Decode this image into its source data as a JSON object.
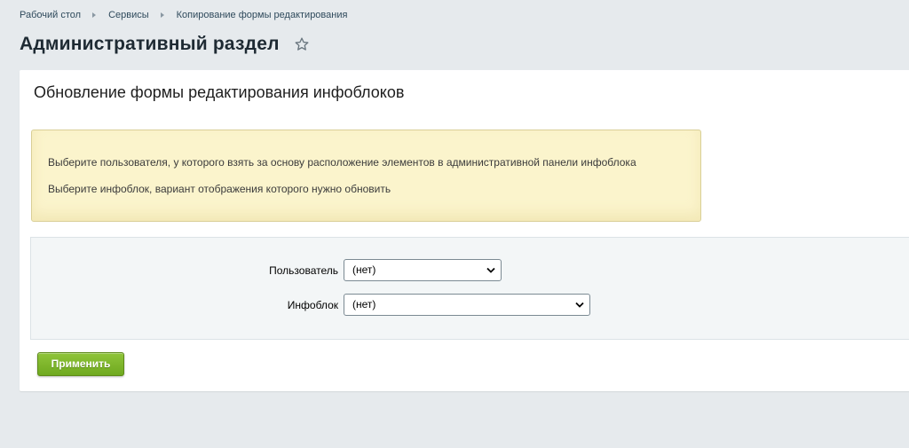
{
  "breadcrumb": {
    "items": [
      {
        "label": "Рабочий стол"
      },
      {
        "label": "Сервисы"
      },
      {
        "label": "Копирование формы редактирования"
      }
    ]
  },
  "header": {
    "title": "Административный раздел",
    "favorite_icon": "star-icon"
  },
  "main": {
    "title": "Обновление формы редактирования инфоблоков",
    "note": {
      "line1": "Выберите пользователя, у которого взять за основу расположение элементов в административной панели инфоблока",
      "line2": "Выберите инфоблок, вариант отображения которого нужно обновить"
    },
    "form": {
      "user": {
        "label": "Пользователь",
        "value": "(нет)"
      },
      "iblock": {
        "label": "Инфоблок",
        "value": "(нет)"
      }
    },
    "apply_label": "Применить"
  },
  "colors": {
    "background": "#e6eaed",
    "note_background": "#fbf4cc",
    "accent_green": "#7ab52a"
  }
}
